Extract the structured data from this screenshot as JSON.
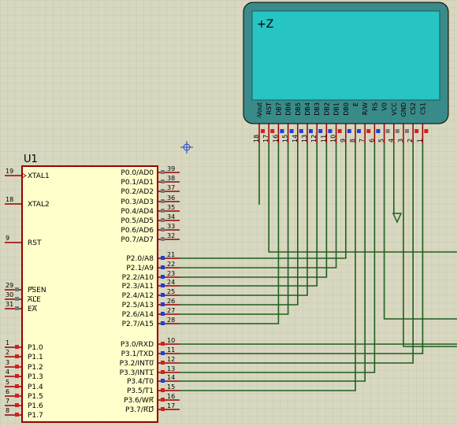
{
  "colors": {
    "background": "#d8d8c0",
    "grid": "#c8c8b0",
    "body_fill": "#ffffcc",
    "outline": "#990000",
    "wire": "#1f5e1f",
    "pin_label": "#000000",
    "pin_number": "#000000",
    "lcd_frame": "#3a8a8a",
    "lcd_screen": "#27c4c4",
    "pin_blue": "#1f3fd6",
    "pin_red": "#d41f1f",
    "pin_gray": "#7a7a7a"
  },
  "mcu": {
    "ref": "U1",
    "left_pins": [
      {
        "num": "19",
        "label": "XTAL1",
        "clock": true
      },
      {
        "num": "18",
        "label": "XTAL2"
      },
      {
        "num": "9",
        "label": "RST"
      },
      {
        "num": "29",
        "label": "PSEN",
        "overline": true
      },
      {
        "num": "30",
        "label": "ALE",
        "overline": true
      },
      {
        "num": "31",
        "label": "EA",
        "overline": true
      },
      {
        "num": "1",
        "label": "P1.0"
      },
      {
        "num": "2",
        "label": "P1.1"
      },
      {
        "num": "3",
        "label": "P1.2"
      },
      {
        "num": "4",
        "label": "P1.3"
      },
      {
        "num": "5",
        "label": "P1.4"
      },
      {
        "num": "6",
        "label": "P1.5"
      },
      {
        "num": "7",
        "label": "P1.6"
      },
      {
        "num": "8",
        "label": "P1.7"
      }
    ],
    "right_pins": [
      {
        "num": "39",
        "label": "P0.0/AD0",
        "state": "gray"
      },
      {
        "num": "38",
        "label": "P0.1/AD1",
        "state": "gray"
      },
      {
        "num": "37",
        "label": "P0.2/AD2",
        "state": "gray"
      },
      {
        "num": "36",
        "label": "P0.3/AD3",
        "state": "gray"
      },
      {
        "num": "35",
        "label": "P0.4/AD4",
        "state": "gray"
      },
      {
        "num": "34",
        "label": "P0.5/AD5",
        "state": "gray"
      },
      {
        "num": "33",
        "label": "P0.6/AD6",
        "state": "gray"
      },
      {
        "num": "32",
        "label": "P0.7/AD7",
        "state": "gray"
      },
      {
        "num": "21",
        "label": "P2.0/A8",
        "state": "blue"
      },
      {
        "num": "22",
        "label": "P2.1/A9",
        "state": "blue"
      },
      {
        "num": "23",
        "label": "P2.2/A10",
        "state": "blue"
      },
      {
        "num": "24",
        "label": "P2.3/A11",
        "state": "blue"
      },
      {
        "num": "25",
        "label": "P2.4/A12",
        "state": "blue"
      },
      {
        "num": "26",
        "label": "P2.5/A13",
        "state": "blue"
      },
      {
        "num": "27",
        "label": "P2.6/A14",
        "state": "blue"
      },
      {
        "num": "28",
        "label": "P2.7/A15",
        "state": "blue"
      },
      {
        "num": "10",
        "label": "P3.0/RXD",
        "state": "red"
      },
      {
        "num": "11",
        "label": "P3.1/TXD",
        "state": "blue"
      },
      {
        "num": "12",
        "label": "P3.2/INT0",
        "state": "red",
        "overline_part": "INT0"
      },
      {
        "num": "13",
        "label": "P3.3/INT1",
        "state": "red",
        "overline_part": "INT1"
      },
      {
        "num": "14",
        "label": "P3.4/T0",
        "state": "blue"
      },
      {
        "num": "15",
        "label": "P3.5/T1",
        "state": "red"
      },
      {
        "num": "16",
        "label": "P3.6/WR",
        "state": "red",
        "overline_part": "WR"
      },
      {
        "num": "17",
        "label": "P3.7/RD",
        "state": "red",
        "overline_part": "RD"
      }
    ]
  },
  "lcd": {
    "screen_glyph": "+Z",
    "pins": [
      {
        "name": "-Vout",
        "num": "18",
        "state": "red"
      },
      {
        "name": "RST",
        "num": "17",
        "state": "red"
      },
      {
        "name": "DB7",
        "num": "16",
        "state": "blue"
      },
      {
        "name": "DB6",
        "num": "15",
        "state": "blue"
      },
      {
        "name": "DB5",
        "num": "14",
        "state": "blue"
      },
      {
        "name": "DB4",
        "num": "13",
        "state": "blue"
      },
      {
        "name": "DB3",
        "num": "12",
        "state": "blue"
      },
      {
        "name": "DB2",
        "num": "11",
        "state": "blue"
      },
      {
        "name": "DB1",
        "num": "10",
        "state": "red"
      },
      {
        "name": "DB0",
        "num": "9",
        "state": "blue"
      },
      {
        "name": "E",
        "num": "8",
        "state": "blue"
      },
      {
        "name": "R/W",
        "num": "7",
        "state": "red"
      },
      {
        "name": "RS",
        "num": "6",
        "state": "blue"
      },
      {
        "name": "V0",
        "num": "5",
        "state": "gray"
      },
      {
        "name": "VCC",
        "num": "4",
        "state": "gray"
      },
      {
        "name": "GND",
        "num": "3",
        "state": "gray"
      },
      {
        "name": "CS2",
        "num": "2",
        "state": "red"
      },
      {
        "name": "CS1",
        "num": "1",
        "state": "red"
      }
    ]
  }
}
